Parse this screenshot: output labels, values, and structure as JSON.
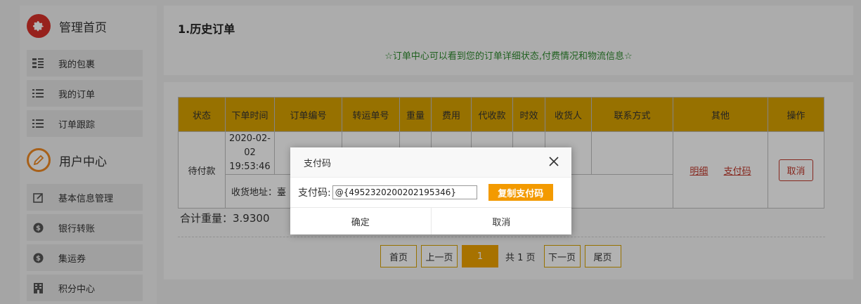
{
  "sidebar": {
    "section1": {
      "title": "管理首页",
      "icon": "gear-icon"
    },
    "items1": [
      {
        "label": "我的包裹",
        "icon": "grid-list-icon"
      },
      {
        "label": "我的订单",
        "icon": "list-icon"
      },
      {
        "label": "订单跟踪",
        "icon": "list-icon"
      }
    ],
    "section2": {
      "title": "用户中心",
      "icon": "pencil-icon"
    },
    "items2": [
      {
        "label": "基本信息管理",
        "icon": "edit-icon"
      },
      {
        "label": "银行转账",
        "icon": "dollar-coin-icon"
      },
      {
        "label": "集运券",
        "icon": "dollar-coin-icon"
      },
      {
        "label": "积分中心",
        "icon": "building-icon"
      }
    ]
  },
  "header": {
    "title": "1.历史订单",
    "note": "☆订单中心可以看到您的订单详细状态,付费情况和物流信息☆"
  },
  "table": {
    "columns": [
      "状态",
      "下单时间",
      "订单编号",
      "转运单号",
      "重量",
      "费用",
      "代收款",
      "时效",
      "收货人",
      "联系方式",
      "其他",
      "操作"
    ],
    "row": {
      "status": "待付款",
      "date": "2020-02-02",
      "time": "19:53:46",
      "address_label": "收货地址：臺",
      "link_detail": "明细",
      "link_paycode": "支付码",
      "action_cancel": "取消"
    }
  },
  "summary": {
    "total_weight": "合计重量：3.9300"
  },
  "pager": {
    "first": "首页",
    "prev": "上一页",
    "current": "1",
    "total": "共 1 页",
    "next": "下一页",
    "last": "尾页"
  },
  "dialog": {
    "title": "支付码",
    "label": "支付码:",
    "code": "@{495232020020219534 6}",
    "code_value": "@{4952320200202195346}",
    "copy_button": "复制支付码",
    "confirm": "确定",
    "cancel": "取消"
  },
  "colors": {
    "accent": "#d8a200",
    "primary_orange": "#f39a00",
    "danger": "#c0392b",
    "note_green": "#2e8b2e"
  }
}
